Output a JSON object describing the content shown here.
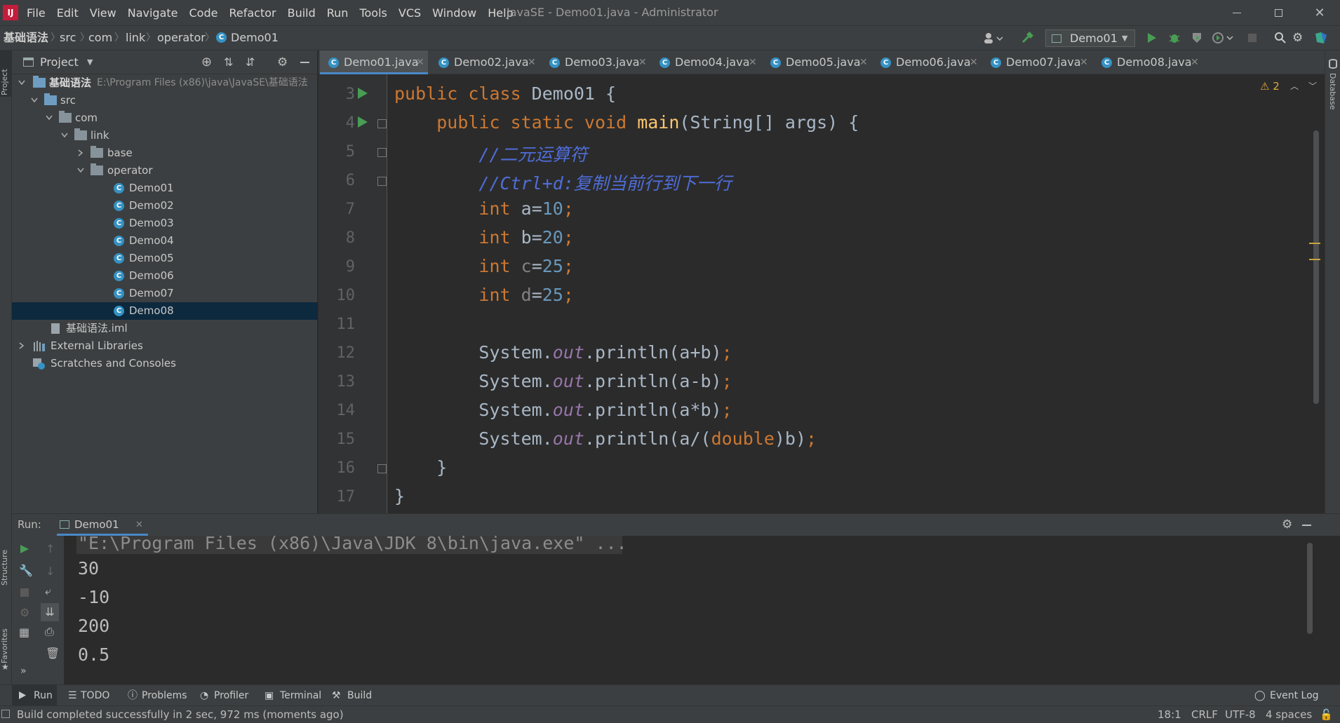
{
  "window": {
    "title": "JavaSE - Demo01.java - Administrator"
  },
  "menu": [
    "File",
    "Edit",
    "View",
    "Navigate",
    "Code",
    "Refactor",
    "Build",
    "Run",
    "Tools",
    "VCS",
    "Window",
    "Help"
  ],
  "breadcrumb": [
    "基础语法",
    "src",
    "com",
    "link",
    "operator",
    "Demo01"
  ],
  "toolbar": {
    "run_config": "Demo01"
  },
  "project": {
    "header": "Project",
    "root_name": "基础语法",
    "root_path": "E:\\Program Files (x86)\\java\\JavaSE\\基础语法",
    "nodes": [
      "src",
      "com",
      "link",
      "base",
      "operator",
      "Demo01",
      "Demo02",
      "Demo03",
      "Demo04",
      "Demo05",
      "Demo06",
      "Demo07",
      "Demo08",
      "基础语法.iml",
      "External Libraries",
      "Scratches and Consoles"
    ],
    "selected": "Demo08"
  },
  "tabs": [
    "Demo01.java",
    "Demo02.java",
    "Demo03.java",
    "Demo04.java",
    "Demo05.java",
    "Demo06.java",
    "Demo07.java",
    "Demo08.java"
  ],
  "editor": {
    "warnings": "2",
    "line_numbers": [
      "3",
      "4",
      "5",
      "6",
      "7",
      "8",
      "9",
      "10",
      "11",
      "12",
      "13",
      "14",
      "15",
      "16",
      "17"
    ],
    "lines": [
      "public class Demo01 {",
      "    public static void main(String[] args) {",
      "        //二元运算符",
      "        //Ctrl+d:复制当前行到下一行",
      "        int a=10;",
      "        int b=20;",
      "        int c=25;",
      "        int d=25;",
      "",
      "        System.out.println(a+b);",
      "        System.out.println(a-b);",
      "        System.out.println(a*b);",
      "        System.out.println(a/(double)b);",
      "    }",
      "}"
    ]
  },
  "run": {
    "label": "Run:",
    "tab": "Demo01",
    "command": "\"E:\\Program Files (x86)\\Java\\JDK 8\\bin\\java.exe\" ...",
    "output": [
      "30",
      "-10",
      "200",
      "0.5"
    ]
  },
  "left_tools": [
    "Project",
    "Structure",
    "Favorites"
  ],
  "right_tools": [
    "Database"
  ],
  "bottom_tabs": [
    "Run",
    "TODO",
    "Problems",
    "Profiler",
    "Terminal",
    "Build"
  ],
  "event_log": "Event Log",
  "status": {
    "message": "Build completed successfully in 2 sec, 972 ms (moments ago)",
    "position": "18:1",
    "line_sep": "CRLF",
    "encoding": "UTF-8",
    "indent": "4 spaces"
  },
  "colors": {
    "accent": "#4a88c7",
    "run_green": "#499c54",
    "selection": "#0d293e",
    "keyword": "#cc7832",
    "comment": "#629755"
  }
}
